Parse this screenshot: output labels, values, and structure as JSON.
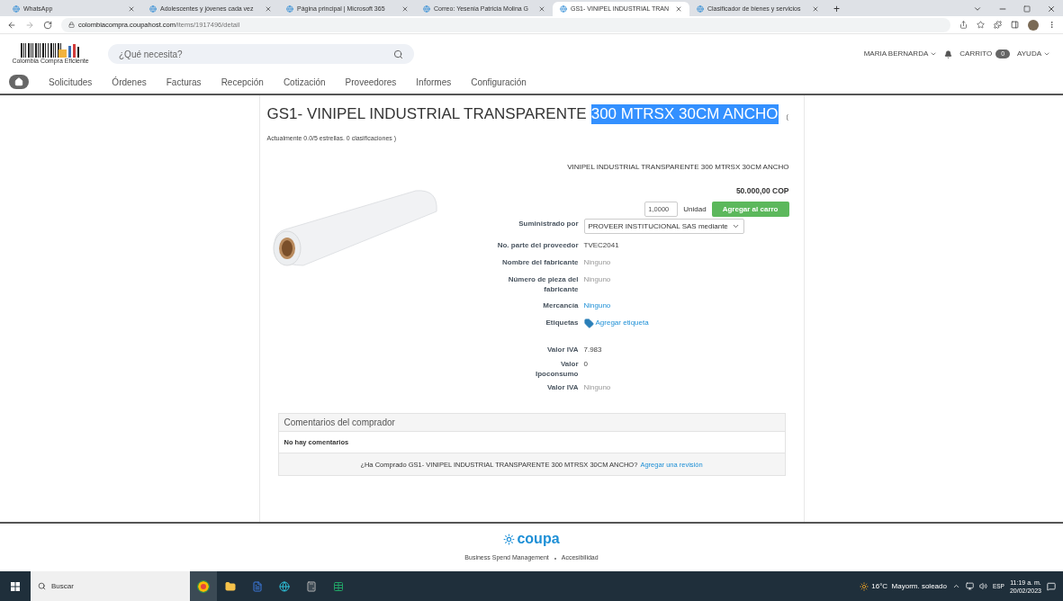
{
  "browser": {
    "tabs": [
      {
        "title": "WhatsApp",
        "selected": false
      },
      {
        "title": "Adolescentes y jóvenes cada vez",
        "selected": false
      },
      {
        "title": "Página principal | Microsoft 365",
        "selected": false
      },
      {
        "title": "Correo: Yesenia Patricia Molina G",
        "selected": false
      },
      {
        "title": "GS1- VINIPEL INDUSTRIAL TRAN",
        "selected": true
      },
      {
        "title": "Clasificador de bienes y servicios",
        "selected": false
      }
    ],
    "new_tab": "+",
    "url_host": "colombiacompra.coupahost.com",
    "url_path": "/items/1917496/detail"
  },
  "header": {
    "logo_caption": "Colombia Compra Eficiente",
    "search": {
      "placeholder": "¿Qué necesita?"
    },
    "user": "MARIA BERNARDA",
    "cart_label": "CARRITO",
    "cart_count": "0",
    "help": "AYUDA"
  },
  "nav": [
    "Solicitudes",
    "Órdenes",
    "Facturas",
    "Recepción",
    "Cotización",
    "Proveedores",
    "Informes",
    "Configuración"
  ],
  "product": {
    "title": [
      {
        "text": "GS1- VINIPEL INDUSTRIAL TRANSPARENTE",
        "selected": false
      },
      {
        "text": "300 MTRSX 30CM ANCHO",
        "selected": true
      }
    ],
    "rating_open": "(",
    "rating": "Actualmente 0.0/5 estrellas. 0 clasificaciones )",
    "name": "VINIPEL INDUSTRIAL TRANSPARENTE 300 MTRSX 30CM ANCHO",
    "price": "50.000,00 COP",
    "quantity": "1,0000",
    "unit": "Unidad",
    "add_button": "Agregar al carro",
    "fields": [
      {
        "label": "Suministrado por",
        "value": "PROVEER INSTITUCIONAL SAS mediante",
        "kind": "select"
      },
      {
        "label": "No. parte del proveedor",
        "value": "TVEC2041",
        "kind": "text"
      },
      {
        "label": "Nombre del fabricante",
        "value": "Ninguno",
        "kind": "muted"
      },
      {
        "label": "Número de pieza del fabricante",
        "value": "Ninguno",
        "kind": "muted"
      },
      {
        "label": "Mercancía",
        "value": "Ninguno",
        "kind": "link"
      },
      {
        "label": "Etiquetas",
        "value": "Agregar etiqueta",
        "kind": "tag"
      }
    ],
    "tax_fields": [
      {
        "label": "Valor IVA",
        "value": "7.983",
        "kind": "text"
      },
      {
        "label": "Valor Ipoconsumo",
        "value": "0",
        "kind": "text"
      },
      {
        "label": "Valor IVA",
        "value": "Ninguno",
        "kind": "muted"
      }
    ]
  },
  "comments": {
    "title": "Comentarios del comprador",
    "empty": "No hay comentarios",
    "question": "¿Ha Comprado GS1- VINIPEL INDUSTRIAL TRANSPARENTE 300 MTRSX 30CM ANCHO?",
    "review_link": "Agregar una revisión"
  },
  "footer": {
    "brand": "coupa",
    "links": [
      "Business Spend Management",
      "Accesibilidad"
    ]
  },
  "taskbar": {
    "search_placeholder": "Buscar",
    "weather": "16°C  Mayorm. soleado",
    "language": "ESP",
    "time": "11:19 a. m.",
    "date": "20/02/2023"
  }
}
